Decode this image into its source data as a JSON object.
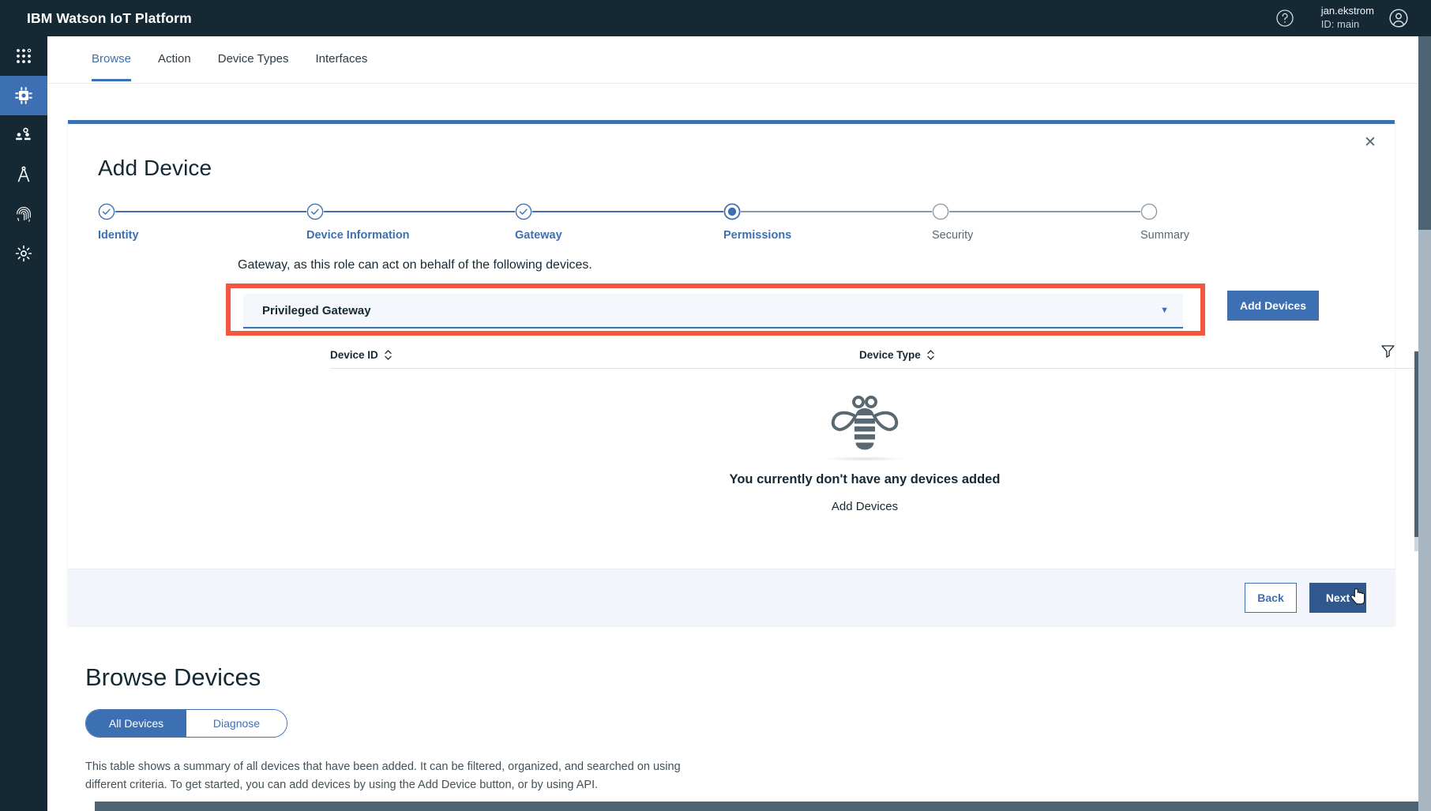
{
  "header": {
    "brand": "IBM Watson IoT Platform",
    "help_icon": "help-circle-icon",
    "user_name": "jan.ekstrom",
    "user_id": "ID: main",
    "avatar_icon": "user-avatar-icon"
  },
  "rail": {
    "items": [
      {
        "icon": "apps-grid-icon",
        "active": false
      },
      {
        "icon": "chip-device-icon",
        "active": true
      },
      {
        "icon": "users-group-icon",
        "active": false
      },
      {
        "icon": "compass-drafting-icon",
        "active": false
      },
      {
        "icon": "fingerprint-icon",
        "active": false
      },
      {
        "icon": "gear-settings-icon",
        "active": false
      }
    ]
  },
  "tabs": [
    {
      "label": "Browse",
      "active": true
    },
    {
      "label": "Action",
      "active": false
    },
    {
      "label": "Device Types",
      "active": false
    },
    {
      "label": "Interfaces",
      "active": false
    }
  ],
  "modal": {
    "title": "Add Device",
    "close_icon": "close-icon",
    "steps": [
      {
        "label": "Identity",
        "state": "done"
      },
      {
        "label": "Device Information",
        "state": "done"
      },
      {
        "label": "Gateway",
        "state": "done"
      },
      {
        "label": "Permissions",
        "state": "current"
      },
      {
        "label": "Security",
        "state": "todo"
      },
      {
        "label": "Summary",
        "state": "todo"
      }
    ],
    "role_description": "Gateway, as this role can act on behalf of the following devices.",
    "dropdown": {
      "value": "Privileged Gateway",
      "caret_icon": "chevron-down-icon"
    },
    "add_devices_button": "Add Devices",
    "table": {
      "columns": [
        {
          "label": "Device ID",
          "sort_icon": "sort-arrows-icon"
        },
        {
          "label": "Device Type",
          "sort_icon": "sort-arrows-icon"
        }
      ],
      "filter_icon": "filter-icon",
      "empty_illustration": "bee-icon",
      "empty_title": "You currently don't have any devices added",
      "empty_link": "Add Devices"
    },
    "footer": {
      "back_label": "Back",
      "next_label": "Next",
      "cursor": "hand-pointer-cursor"
    }
  },
  "browse": {
    "title": "Browse Devices",
    "toggles": [
      {
        "label": "All Devices",
        "active": true
      },
      {
        "label": "Diagnose",
        "active": false
      }
    ],
    "description": "This table shows a summary of all devices that have been added. It can be filtered, organized, and searched on using different criteria. To get started, you can add devices by using the Add Device button, or by using API."
  },
  "colors": {
    "brand_dark": "#152935",
    "accent_blue": "#3d70b2",
    "highlight_red": "#f4573e",
    "next_button": "#30588c"
  }
}
